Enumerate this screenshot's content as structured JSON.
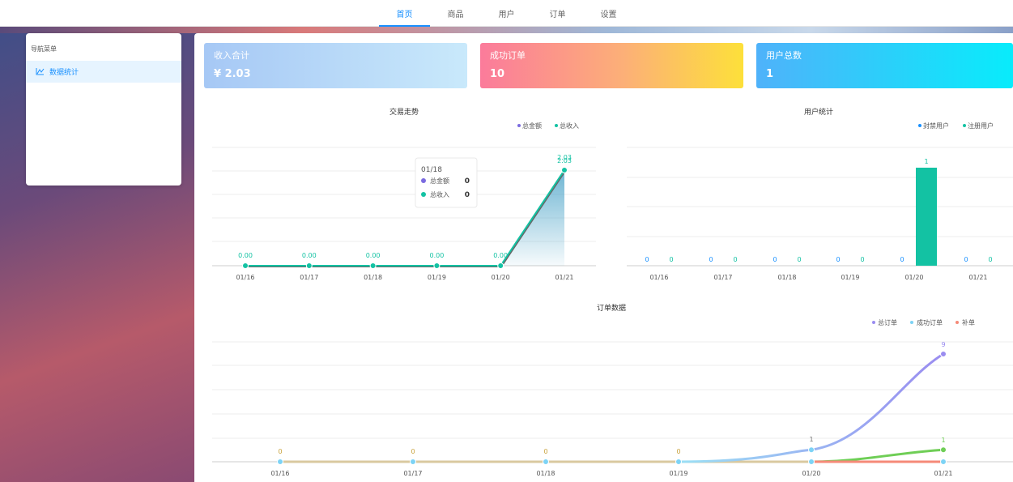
{
  "nav": {
    "items": [
      "首页",
      "商品",
      "用户",
      "订单",
      "设置"
    ],
    "active": 0
  },
  "sidebar": {
    "title": "导航菜单",
    "items": [
      {
        "label": "数据统计",
        "icon": "chart-line-icon"
      }
    ]
  },
  "cards": [
    {
      "title": "收入合计",
      "value": "¥ 2.03"
    },
    {
      "title": "成功订单",
      "value": "10"
    },
    {
      "title": "用户总数",
      "value": "1"
    }
  ],
  "colors": {
    "accent": "#1890ff",
    "teal": "#13c2a3",
    "purple": "#7b6be0",
    "gray": "#666666"
  },
  "chart_data": [
    {
      "type": "line",
      "title": "交易走势",
      "categories": [
        "01/16",
        "01/17",
        "01/18",
        "01/19",
        "01/20",
        "01/21"
      ],
      "series": [
        {
          "name": "总金额",
          "values": [
            0,
            0,
            0,
            0,
            0,
            2.03
          ]
        },
        {
          "name": "总收入",
          "values": [
            0,
            0,
            0,
            0,
            0,
            2.03
          ]
        }
      ],
      "data_labels": [
        "0.00",
        "0.00",
        "0.00",
        "0.00",
        "0.00",
        "2.03"
      ],
      "top_labels": [
        "2.03",
        "2.03"
      ],
      "legend": "top-right",
      "tooltip": {
        "title": "01/18",
        "rows": [
          {
            "name": "总金额",
            "value": "0"
          },
          {
            "name": "总收入",
            "value": "0"
          }
        ]
      }
    },
    {
      "type": "bar",
      "title": "用户统计",
      "categories": [
        "01/16",
        "01/17",
        "01/18",
        "01/19",
        "01/20",
        "01/21"
      ],
      "series": [
        {
          "name": "封禁用户",
          "values": [
            0,
            0,
            0,
            0,
            0,
            0
          ]
        },
        {
          "name": "注册用户",
          "values": [
            0,
            0,
            0,
            0,
            1,
            0
          ]
        }
      ],
      "legend": "top-right"
    },
    {
      "type": "line",
      "title": "订单数据",
      "categories": [
        "01/16",
        "01/17",
        "01/18",
        "01/19",
        "01/20",
        "01/21"
      ],
      "series": [
        {
          "name": "总订单",
          "values": [
            0,
            0,
            0,
            0,
            1,
            9
          ]
        },
        {
          "name": "成功订单",
          "values": [
            0,
            0,
            0,
            0,
            1,
            9
          ]
        },
        {
          "name": "补单",
          "values": [
            0,
            0,
            0,
            0,
            0,
            1
          ]
        }
      ],
      "legend": "top-right"
    }
  ]
}
